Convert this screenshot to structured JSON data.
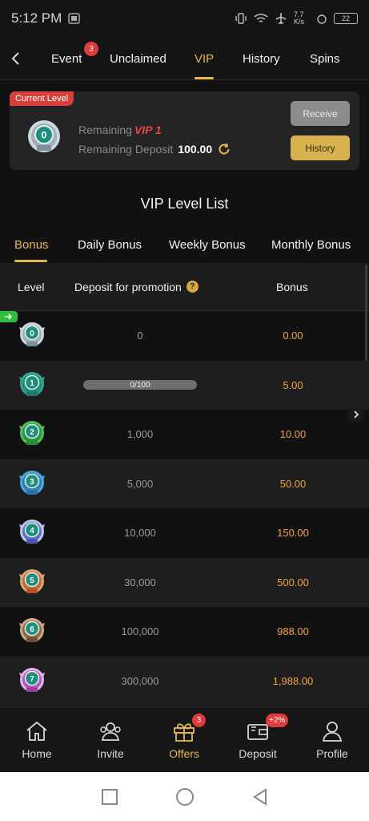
{
  "status_bar": {
    "time": "5:12 PM",
    "speed": "7.7 K/s",
    "battery": "22"
  },
  "top_tabs": [
    {
      "label": "Event",
      "badge": "3"
    },
    {
      "label": "Unclaimed"
    },
    {
      "label": "VIP",
      "active": true
    },
    {
      "label": "History"
    },
    {
      "label": "Spins"
    }
  ],
  "current_level": {
    "tag": "Current Level",
    "level": "0",
    "remaining_label": "Remaining",
    "remaining_vip": "VIP 1",
    "deposit_label": "Remaining Deposit",
    "deposit_amount": "100.00",
    "receive_label": "Receive",
    "history_label": "History"
  },
  "level_list_title": "VIP Level List",
  "bonus_tabs": [
    {
      "label": "Bonus",
      "active": true
    },
    {
      "label": "Daily Bonus"
    },
    {
      "label": "Weekly Bonus"
    },
    {
      "label": "Monthly Bonus"
    }
  ],
  "table": {
    "headers": {
      "level": "Level",
      "deposit": "Deposit for promotion",
      "help": "?",
      "bonus": "Bonus"
    },
    "rows": [
      {
        "level": "0",
        "deposit": "0",
        "bonus": "0.00"
      },
      {
        "level": "1",
        "deposit": "0/100",
        "progress": 0.0,
        "bonus": "5.00"
      },
      {
        "level": "2",
        "deposit": "1,000",
        "bonus": "10.00"
      },
      {
        "level": "3",
        "deposit": "5,000",
        "bonus": "50.00"
      },
      {
        "level": "4",
        "deposit": "10,000",
        "bonus": "150.00"
      },
      {
        "level": "5",
        "deposit": "30,000",
        "bonus": "500.00"
      },
      {
        "level": "6",
        "deposit": "100,000",
        "bonus": "988.00"
      },
      {
        "level": "7",
        "deposit": "300,000",
        "bonus": "1,988.00"
      }
    ]
  },
  "bottom_nav": [
    {
      "label": "Home",
      "icon": "home-icon"
    },
    {
      "label": "Invite",
      "icon": "invite-icon"
    },
    {
      "label": "Offers",
      "icon": "gift-icon",
      "badge": "3",
      "active": true
    },
    {
      "label": "Deposit",
      "icon": "wallet-icon",
      "badge": "+2%"
    },
    {
      "label": "Profile",
      "icon": "profile-icon"
    }
  ],
  "colors": {
    "accent": "#e6b84a",
    "bonus": "#f2a43a",
    "badge": "#e03a3a",
    "background": "#111111"
  }
}
